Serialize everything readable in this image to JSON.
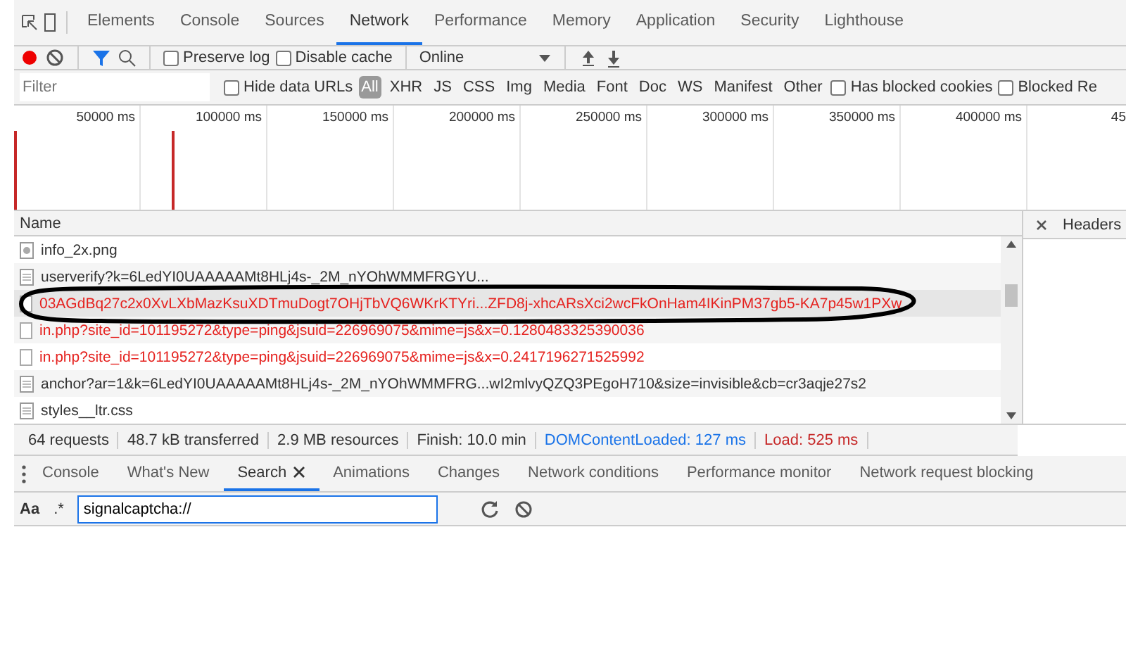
{
  "main_tabs": [
    {
      "label": "Elements",
      "selected": false
    },
    {
      "label": "Console",
      "selected": false
    },
    {
      "label": "Sources",
      "selected": false
    },
    {
      "label": "Network",
      "selected": true
    },
    {
      "label": "Performance",
      "selected": false
    },
    {
      "label": "Memory",
      "selected": false
    },
    {
      "label": "Application",
      "selected": false
    },
    {
      "label": "Security",
      "selected": false
    },
    {
      "label": "Lighthouse",
      "selected": false
    }
  ],
  "toolbar": {
    "recording": true,
    "preserve_log": {
      "label": "Preserve log",
      "checked": false
    },
    "disable_cache": {
      "label": "Disable cache",
      "checked": false
    },
    "throttling": "Online"
  },
  "filter_bar": {
    "placeholder": "Filter",
    "hide_data_urls": {
      "label": "Hide data URLs",
      "checked": false
    },
    "types": [
      {
        "label": "All",
        "selected": true
      },
      {
        "label": "XHR",
        "selected": false
      },
      {
        "label": "JS",
        "selected": false
      },
      {
        "label": "CSS",
        "selected": false
      },
      {
        "label": "Img",
        "selected": false
      },
      {
        "label": "Media",
        "selected": false
      },
      {
        "label": "Font",
        "selected": false
      },
      {
        "label": "Doc",
        "selected": false
      },
      {
        "label": "WS",
        "selected": false
      },
      {
        "label": "Manifest",
        "selected": false
      },
      {
        "label": "Other",
        "selected": false
      }
    ],
    "has_blocked_cookies": {
      "label": "Has blocked cookies",
      "checked": false
    },
    "blocked_requests": {
      "label": "Blocked Re",
      "checked": false
    }
  },
  "timeline": {
    "ticks": [
      "50000 ms",
      "100000 ms",
      "150000 ms",
      "200000 ms",
      "250000 ms",
      "300000 ms",
      "350000 ms",
      "400000 ms",
      "45"
    ]
  },
  "requests": {
    "column": "Name",
    "rows": [
      {
        "name": "info_2x.png",
        "kind": "image",
        "failed": false,
        "selected": false
      },
      {
        "name": "userverify?k=6LedYI0UAAAAAMt8HLj4s-_2M_nYOhWMMFRGYU...",
        "kind": "document",
        "failed": false,
        "selected": false
      },
      {
        "name": "03AGdBq27c2x0XvLXbMazKsuXDTmuDogt7OHjTbVQ6WKrKTYri...ZFD8j-xhcARsXci2wcFkOnHam4IKinPM37gb5-KA7p45w1PXw",
        "kind": "blank",
        "failed": true,
        "selected": true
      },
      {
        "name": "in.php?site_id=101195272&type=ping&jsuid=226969075&mime=js&x=0.1280483325390036",
        "kind": "blank",
        "failed": true,
        "selected": false
      },
      {
        "name": "in.php?site_id=101195272&type=ping&jsuid=226969075&mime=js&x=0.2417196271525992",
        "kind": "blank",
        "failed": true,
        "selected": false
      },
      {
        "name": "anchor?ar=1&k=6LedYI0UAAAAAMt8HLj4s-_2M_nYOhWMMFRG...wI2mlvyQZQ3PEgoH710&size=invisible&cb=cr3aqje27s2",
        "kind": "document",
        "failed": false,
        "selected": false
      },
      {
        "name": "styles__ltr.css",
        "kind": "document",
        "failed": false,
        "selected": false
      }
    ]
  },
  "details_panel": {
    "tab": "Headers"
  },
  "status_bar": [
    {
      "text": "64 requests",
      "kind": "plain"
    },
    {
      "text": "48.7 kB transferred",
      "kind": "plain"
    },
    {
      "text": "2.9 MB resources",
      "kind": "plain"
    },
    {
      "text": "Finish: 10.0 min",
      "kind": "plain"
    },
    {
      "text": "DOMContentLoaded: 127 ms",
      "kind": "dom"
    },
    {
      "text": "Load: 525 ms",
      "kind": "load"
    }
  ],
  "drawer_tabs": [
    {
      "label": "Console",
      "selected": false
    },
    {
      "label": "What's New",
      "selected": false
    },
    {
      "label": "Search",
      "selected": true,
      "closable": true
    },
    {
      "label": "Animations",
      "selected": false
    },
    {
      "label": "Changes",
      "selected": false
    },
    {
      "label": "Network conditions",
      "selected": false
    },
    {
      "label": "Performance monitor",
      "selected": false
    },
    {
      "label": "Network request blocking",
      "selected": false
    }
  ],
  "search": {
    "match_case": "Aa",
    "regex": ".*",
    "value": "signalcaptcha://"
  }
}
